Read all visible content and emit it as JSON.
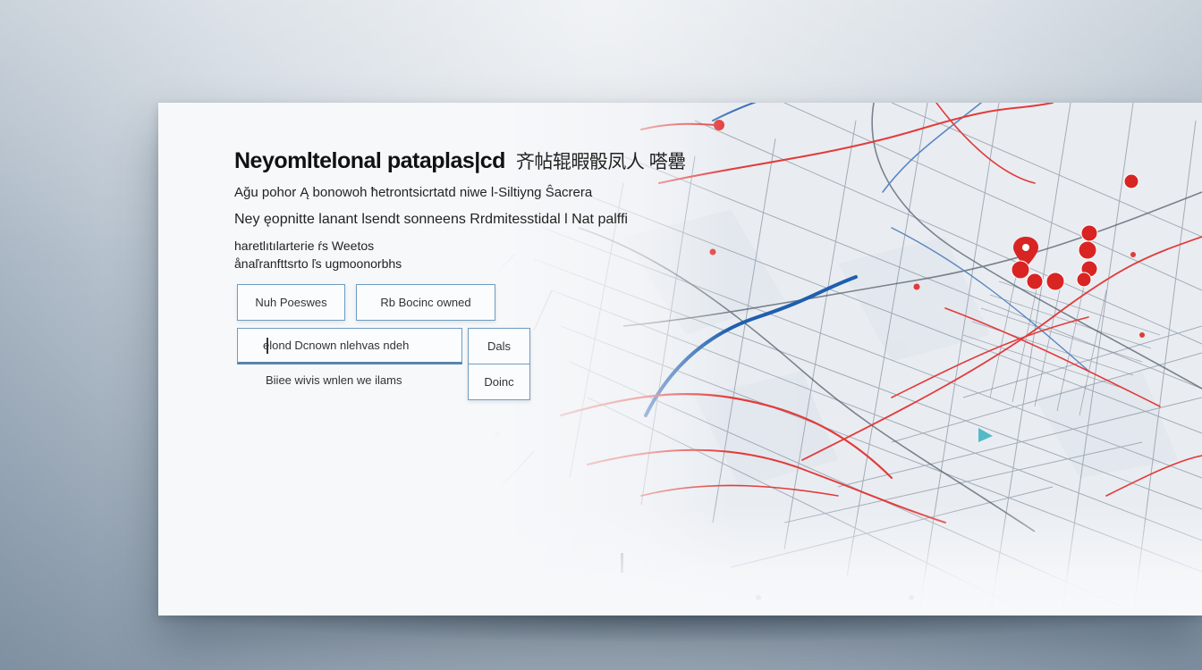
{
  "panel": {
    "title": "Neyomltelonal pataplas|cd",
    "title_cjk": "齐帖辊暇骰凤人 嗒罍",
    "subtitle_1": "Ağu pohor Ą bonowoh ħetrontsicrtatd niwe l-Siltiyng Ŝacrera",
    "subtitle_2": "Ney ęopnitte lanant lsendt sonneens Rrdmitesstidal l Nat palffi",
    "subtitle_3": "haretlıtılarterie      ŕs Weetos",
    "subtitle_4": "ånaľranfttsrto ľs ugmoonorbhs"
  },
  "buttons": {
    "btn_a": "Nuh Poeswes",
    "btn_b": "Rb Bocinc owned",
    "btn_c": "Dals",
    "btn_d": "Doinc"
  },
  "search": {
    "value": "elond Dcnown nlehvas ndeh"
  },
  "hint": "Biiee  wivis   wnlen   we ilams",
  "colors": {
    "accent_border": "#6f9cbf",
    "road_primary": "#1f5fae",
    "road_red": "#e23b3b",
    "pin": "#d92424"
  },
  "icons": [
    "map-pin-icon",
    "location-dot-icon",
    "navigation-arrow-icon"
  ]
}
